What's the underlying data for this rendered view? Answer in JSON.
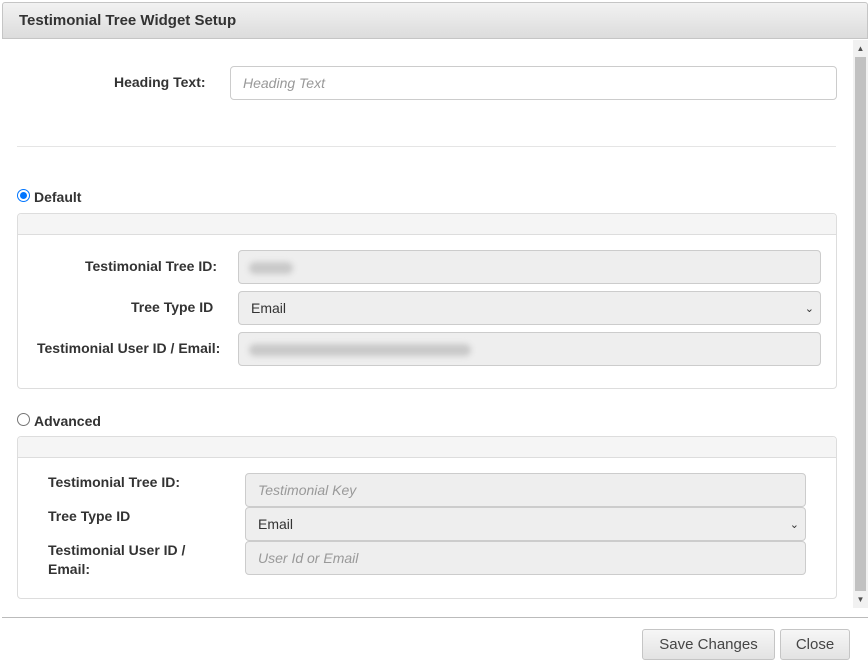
{
  "dialog": {
    "title": "Testimonial Tree Widget Setup"
  },
  "heading": {
    "label": "Heading Text:",
    "placeholder": "Heading Text"
  },
  "default_section": {
    "radio_label": "Default",
    "selected": true,
    "tree_id_label": "Testimonial Tree ID:",
    "tree_type_label": "Tree Type ID",
    "tree_type_value": "Email",
    "user_id_label": "Testimonial User ID / Email:"
  },
  "advanced_section": {
    "radio_label": "Advanced",
    "selected": false,
    "tree_id_label": "Testimonial Tree ID:",
    "tree_id_placeholder": "Testimonial Key",
    "tree_type_label": "Tree Type ID",
    "tree_type_value": "Email",
    "user_id_label_line1": "Testimonial User ID /",
    "user_id_label_line2": "Email:",
    "user_id_placeholder": "User Id or Email"
  },
  "buttons": {
    "save": "Save Changes",
    "close": "Close"
  },
  "colors": {
    "radio_accent": "#0075ff",
    "disabled_field": "#eeeeee"
  }
}
